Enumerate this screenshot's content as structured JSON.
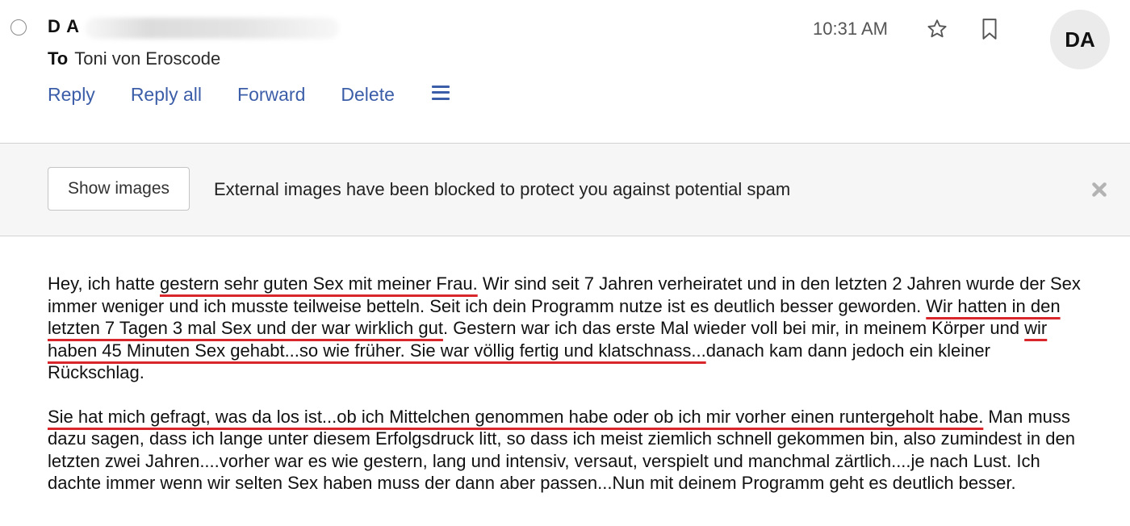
{
  "header": {
    "sender": "D A",
    "to_label": "To",
    "recipient": "Toni von Eroscode",
    "time": "10:31 AM",
    "avatar_initials": "DA",
    "star_icon": "star-outline-icon",
    "bookmark_icon": "bookmark-outline-icon",
    "select_icon": "radio-circle-icon"
  },
  "actions": {
    "reply": "Reply",
    "reply_all": "Reply all",
    "forward": "Forward",
    "delete": "Delete",
    "more_icon": "hamburger-menu-icon"
  },
  "banner": {
    "button": "Show images",
    "message": "External images have been blocked to protect you against potential spam",
    "close_icon": "close-icon"
  },
  "colors": {
    "link": "#3c5ea8",
    "underline": "#d9262b",
    "banner_bg": "#f6f6f6"
  },
  "message": {
    "p1": [
      {
        "text": "Hey, ich hatte ",
        "u": false
      },
      {
        "text": "gestern sehr guten Sex mit meiner Frau.",
        "u": true
      },
      {
        "text": " Wir sind seit 7 Jahren verheiratet und in den letzten 2 Jahren wurde der Sex immer weniger und ich musste teilweise betteln. Seit ich dein Programm nutze ist es deutlich besser geworden. ",
        "u": false
      },
      {
        "text": "Wir hatten in den letzten 7 Tagen 3 mal Sex und der war wirklich gut",
        "u": true
      },
      {
        "text": ". Gestern war ich das erste Mal wieder voll bei mir, in meinem Körper und ",
        "u": false
      },
      {
        "text": "wir haben 45 Minuten Sex gehabt...so wie früher. Sie war völlig fertig und klatschnass...",
        "u": true
      },
      {
        "text": "danach kam dann jedoch ein kleiner Rückschlag.",
        "u": false
      }
    ],
    "p2": [
      {
        "text": "Sie hat mich gefragt, was da los ist...ob ich Mittelchen genommen habe oder ob ich mir vorher einen runtergeholt habe.",
        "u": true
      },
      {
        "text": " Man muss dazu sagen, dass ich lange unter diesem Erfolgsdruck litt, so dass ich meist ziemlich schnell gekommen bin, also zumindest in den letzten zwei Jahren....vorher war es wie gestern, lang und intensiv, versaut, verspielt und manchmal zärtlich....je nach Lust. Ich dachte immer wenn wir selten Sex haben muss der dann aber passen...Nun mit deinem Programm geht es deutlich besser.",
        "u": false
      }
    ]
  }
}
